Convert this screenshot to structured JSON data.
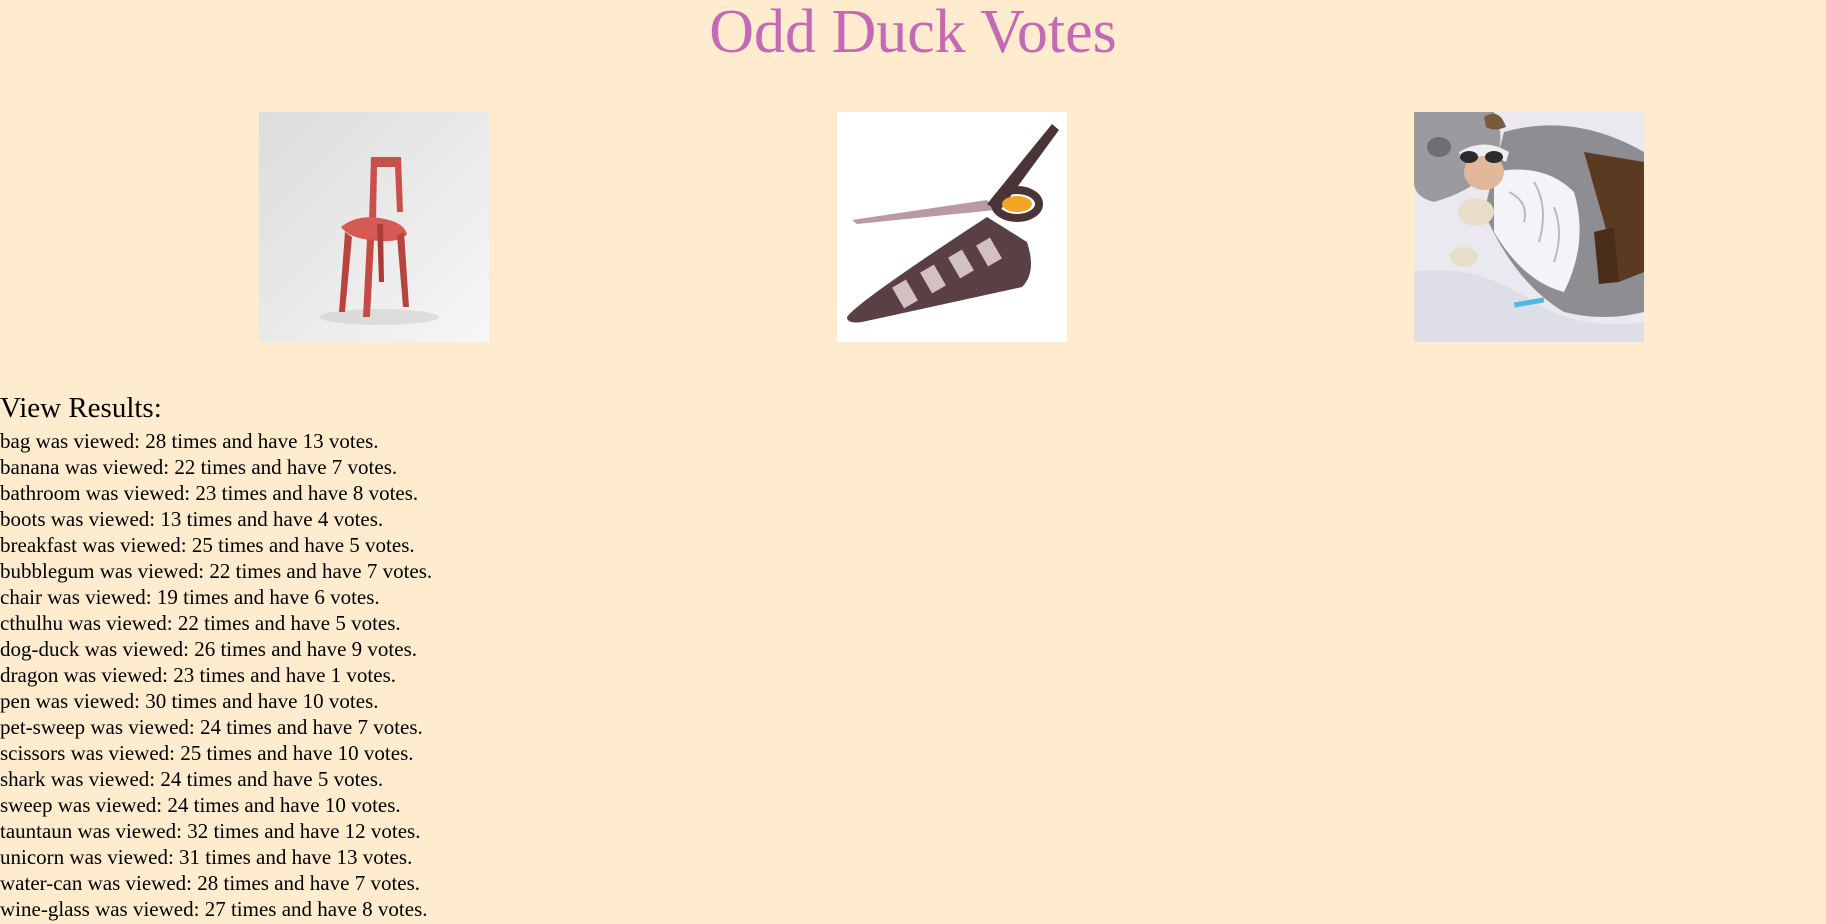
{
  "page": {
    "title": "Odd Duck Votes"
  },
  "products": {
    "left": {
      "name": "chair",
      "icon": "red-chair-image"
    },
    "middle": {
      "name": "scissors",
      "icon": "pizza-scissors-image"
    },
    "right": {
      "name": "tauntaun",
      "icon": "tauntaun-sleeping-bag-image"
    }
  },
  "results": {
    "heading": "View Results:",
    "items": [
      "bag was viewed: 28 times and have 13 votes.",
      "banana was viewed: 22 times and have 7 votes.",
      "bathroom was viewed: 23 times and have 8 votes.",
      "boots was viewed: 13 times and have 4 votes.",
      "breakfast was viewed: 25 times and have 5 votes.",
      "bubblegum was viewed: 22 times and have 7 votes.",
      "chair was viewed: 19 times and have 6 votes.",
      "cthulhu was viewed: 22 times and have 5 votes.",
      "dog-duck was viewed: 26 times and have 9 votes.",
      "dragon was viewed: 23 times and have 1 votes.",
      "pen was viewed: 30 times and have 10 votes.",
      "pet-sweep was viewed: 24 times and have 7 votes.",
      "scissors was viewed: 25 times and have 10 votes.",
      "shark was viewed: 24 times and have 5 votes.",
      "sweep was viewed: 24 times and have 10 votes.",
      "tauntaun was viewed: 32 times and have 12 votes.",
      "unicorn was viewed: 31 times and have 13 votes.",
      "water-can was viewed: 28 times and have 7 votes.",
      "wine-glass was viewed: 27 times and have 8 votes."
    ]
  },
  "colors": {
    "background": "#ffebcd",
    "title": "#c469b5"
  }
}
